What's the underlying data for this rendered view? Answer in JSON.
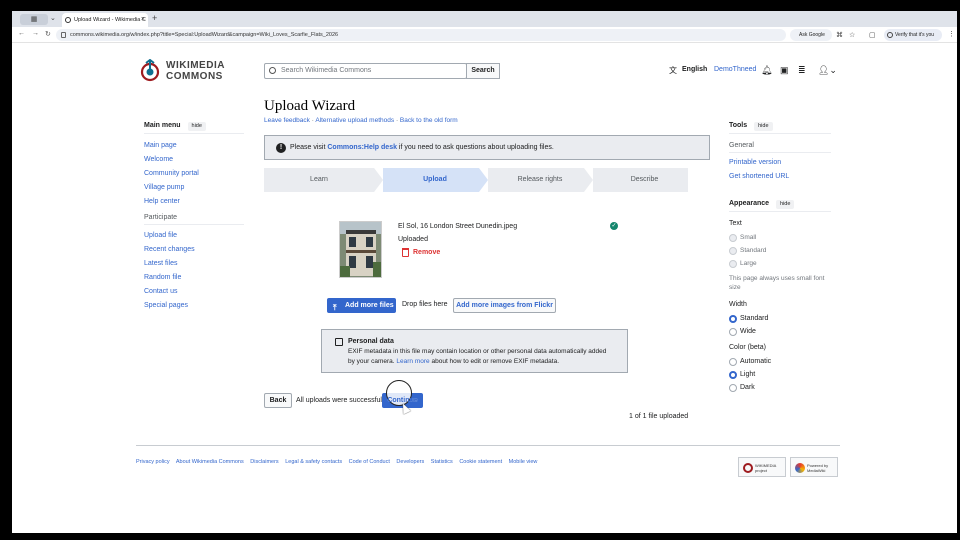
{
  "browser": {
    "tab_title": "Upload Wizard - Wikimedia C",
    "url": "commons.wikimedia.org/w/index.php?title=Special:UploadWizard&campaign=Wiki_Loves_Scarfie_Flats_2026",
    "ask_google": "Ask Google",
    "verify": "Verify that it's you"
  },
  "header": {
    "logo_line1": "WIKIMEDIA",
    "logo_line2": "COMMONS",
    "search_placeholder": "Search Wikimedia Commons",
    "search_button": "Search",
    "language": "English",
    "username": "DemoThneed"
  },
  "main_menu": {
    "title": "Main menu",
    "hide": "hide",
    "items": [
      "Main page",
      "Welcome",
      "Community portal",
      "Village pump",
      "Help center"
    ],
    "participate": "Participate",
    "participate_items": [
      "Upload file",
      "Recent changes",
      "Latest files",
      "Random file",
      "Contact us",
      "Special pages"
    ]
  },
  "tools": {
    "title": "Tools",
    "hide": "hide",
    "general": "General",
    "links": [
      "Printable version",
      "Get shortened URL"
    ]
  },
  "appearance": {
    "title": "Appearance",
    "hide": "hide",
    "text_label": "Text",
    "text_options": [
      "Small",
      "Standard",
      "Large"
    ],
    "text_note": "This page always uses small font size",
    "width_label": "Width",
    "width_options": [
      "Standard",
      "Wide"
    ],
    "color_label": "Color (beta)",
    "color_options": [
      "Automatic",
      "Light",
      "Dark"
    ]
  },
  "content": {
    "title": "Upload Wizard",
    "sublinks": [
      "Leave feedback",
      "Alternative upload methods",
      "Back to the old form"
    ],
    "notice_pre": "Please visit ",
    "notice_link": "Commons:Help desk",
    "notice_post": " if you need to ask questions about uploading files.",
    "steps": [
      "Learn",
      "Upload",
      "Release rights",
      "Describe"
    ],
    "active_step": "Upload",
    "file_name": "El Sol, 16 London Street Dunedin.jpeg",
    "file_status": "Uploaded",
    "remove": "Remove",
    "add_more": "Add more files",
    "drop_files": "Drop files here",
    "add_flickr": "Add more images from Flickr",
    "personal_title": "Personal data",
    "personal_text1": "EXIF metadata in this file may contain location or other personal data automatically added",
    "personal_text2_pre": "by your camera. ",
    "personal_link": "Learn more",
    "personal_text2_post": " about how to edit or remove EXIF metadata.",
    "back": "Back",
    "success": "All uploads were successful!",
    "continue": "Continue",
    "count": "1 of 1 file uploaded"
  },
  "footer": {
    "links": [
      "Privacy policy",
      "About Wikimedia Commons",
      "Disclaimers",
      "Legal & safety contacts",
      "Code of Conduct",
      "Developers",
      "Statistics",
      "Cookie statement",
      "Mobile view"
    ],
    "badge1_line1": "WIKIMEDIA",
    "badge1_line2": "project",
    "badge2_line1": "Powered by",
    "badge2_line2": "MediaWiki"
  },
  "colors": {
    "link": "#3366cc",
    "success": "#14866d",
    "destructive": "#d33333"
  }
}
